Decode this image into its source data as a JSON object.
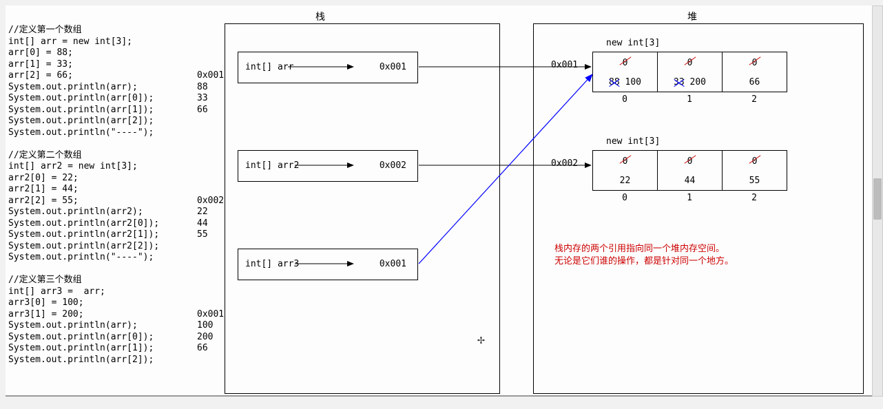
{
  "titles": {
    "stack": "栈",
    "heap": "堆"
  },
  "code": {
    "block1_comment": "//定义第一个数组",
    "block1_lines": [
      "int[] arr = new int[3];",
      "arr[0] = 88;",
      "arr[1] = 33;",
      "arr[2] = 66;",
      "System.out.println(arr);",
      "System.out.println(arr[0]);",
      "System.out.println(arr[1]);",
      "System.out.println(arr[2]);",
      "System.out.println(\"----\");"
    ],
    "block1_out": [
      "",
      "",
      "",
      "",
      "0x001",
      "88",
      "33",
      "66",
      ""
    ],
    "block2_comment": "//定义第二个数组",
    "block2_lines": [
      "int[] arr2 = new int[3];",
      "arr2[0] = 22;",
      "arr2[1] = 44;",
      "arr2[2] = 55;",
      "System.out.println(arr2);",
      "System.out.println(arr2[0]);",
      "System.out.println(arr2[1]);",
      "System.out.println(arr2[2]);",
      "System.out.println(\"----\");"
    ],
    "block2_out": [
      "",
      "",
      "",
      "",
      "0x002",
      "22",
      "44",
      "55",
      ""
    ],
    "block3_comment": "//定义第三个数组",
    "block3_lines": [
      "int[] arr3 =  arr;",
      "arr3[0] = 100;",
      "arr3[1] = 200;",
      "System.out.println(arr);",
      "System.out.println(arr[0]);",
      "System.out.println(arr[1]);",
      "System.out.println(arr[2]);"
    ],
    "block3_out": [
      "",
      "",
      "",
      "0x001",
      "100",
      "200",
      "66"
    ]
  },
  "stack": {
    "vars": [
      {
        "label": "int[] arr",
        "addr": "0x001"
      },
      {
        "label": "int[] arr2",
        "addr": "0x002"
      },
      {
        "label": "int[] arr3",
        "addr": "0x001"
      }
    ]
  },
  "heap": {
    "arrays": [
      {
        "addr": "0x001",
        "decl": "new int[3]",
        "cells": [
          {
            "zero": "0",
            "old": "88",
            "val": "100",
            "strike_old": true
          },
          {
            "zero": "0",
            "old": "33",
            "val": "200",
            "strike_old": true
          },
          {
            "zero": "0",
            "old": "",
            "val": "66",
            "strike_old": false
          }
        ],
        "indices": [
          "0",
          "1",
          "2"
        ]
      },
      {
        "addr": "0x002",
        "decl": "new int[3]",
        "cells": [
          {
            "zero": "0",
            "val": "22"
          },
          {
            "zero": "0",
            "val": "44"
          },
          {
            "zero": "0",
            "val": "55"
          }
        ],
        "indices": [
          "0",
          "1",
          "2"
        ]
      }
    ],
    "note_line1": "栈内存的两个引用指向同一个堆内存空间。",
    "note_line2": "无论是它们谁的操作，都是针对同一个地方。"
  }
}
